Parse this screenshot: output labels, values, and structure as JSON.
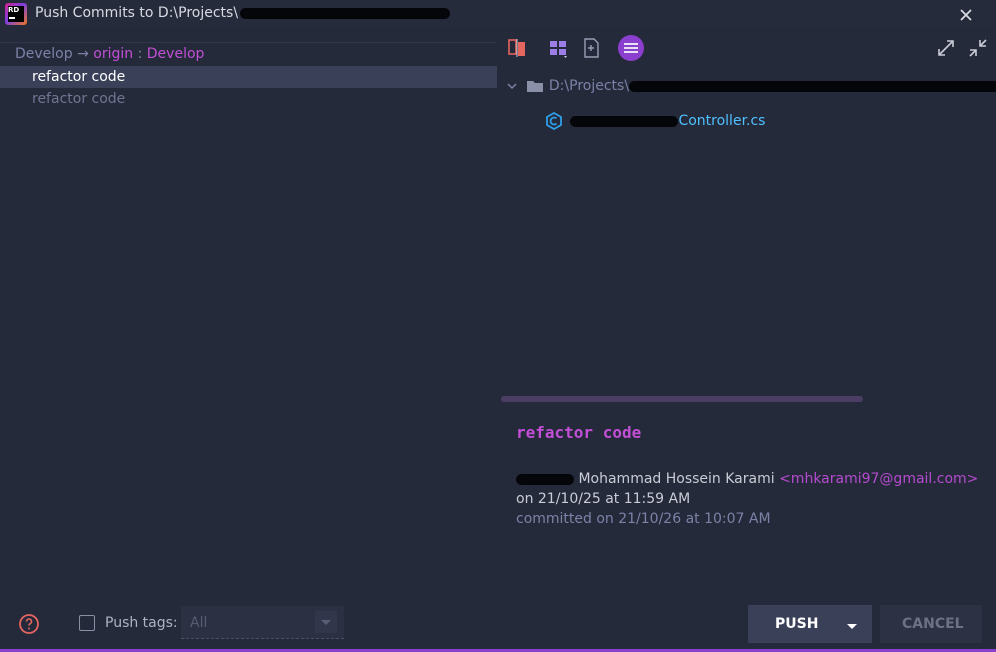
{
  "window": {
    "title": "Push Commits to D:\\Projects\\",
    "app_icon": "rider-logo-icon",
    "app_icon_text": "RD",
    "close_icon": "close-icon"
  },
  "left": {
    "branch": {
      "local": "Develop",
      "arrow": "→",
      "remote": "origin",
      "separator": ":",
      "remote_branch": "Develop"
    },
    "commits": [
      {
        "label": "refactor code",
        "selected": true
      },
      {
        "label": "refactor code",
        "selected": false
      }
    ]
  },
  "toolbar": {
    "buttons": [
      "diff-icon",
      "group-by-icon",
      "show-diff-icon",
      "details-icon"
    ],
    "expand_icon": "expand-all-icon",
    "collapse_icon": "collapse-all-icon"
  },
  "tree": {
    "folder_path": "D:\\Projects\\",
    "file_name": "Controller.cs",
    "file_icon": "csharp-file-icon"
  },
  "details": {
    "message": "refactor code",
    "author_name": "Mohammad Hossein Karami",
    "author_email": "<mhkarami97@gmail.com>",
    "authored": "on 21/10/25 at 11:59 AM",
    "committed": "committed on 21/10/26 at 10:07 AM"
  },
  "footer": {
    "help_icon": "help-icon",
    "push_tags_label": "Push tags:",
    "push_tags_checked": false,
    "tags_value": "All",
    "push_label": "PUSH",
    "cancel_label": "CANCEL"
  },
  "colors": {
    "background": "#252a3a",
    "accent": "#c24fd6",
    "selection": "#3a4057"
  }
}
